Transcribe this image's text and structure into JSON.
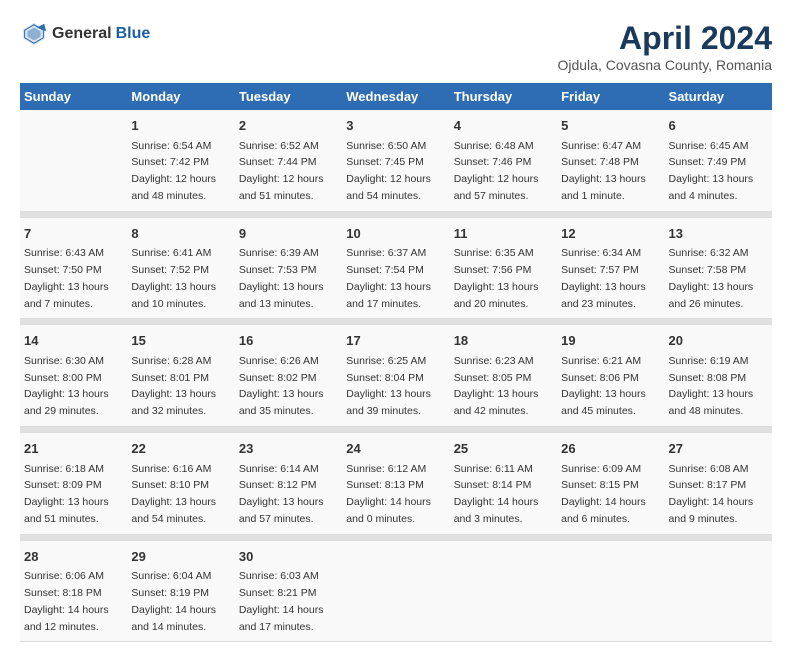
{
  "header": {
    "logo_general": "General",
    "logo_blue": "Blue",
    "title": "April 2024",
    "subtitle": "Ojdula, Covasna County, Romania"
  },
  "weekdays": [
    "Sunday",
    "Monday",
    "Tuesday",
    "Wednesday",
    "Thursday",
    "Friday",
    "Saturday"
  ],
  "weeks": [
    [
      {
        "day": "",
        "sunrise": "",
        "sunset": "",
        "daylight": ""
      },
      {
        "day": "1",
        "sunrise": "Sunrise: 6:54 AM",
        "sunset": "Sunset: 7:42 PM",
        "daylight": "Daylight: 12 hours and 48 minutes."
      },
      {
        "day": "2",
        "sunrise": "Sunrise: 6:52 AM",
        "sunset": "Sunset: 7:44 PM",
        "daylight": "Daylight: 12 hours and 51 minutes."
      },
      {
        "day": "3",
        "sunrise": "Sunrise: 6:50 AM",
        "sunset": "Sunset: 7:45 PM",
        "daylight": "Daylight: 12 hours and 54 minutes."
      },
      {
        "day": "4",
        "sunrise": "Sunrise: 6:48 AM",
        "sunset": "Sunset: 7:46 PM",
        "daylight": "Daylight: 12 hours and 57 minutes."
      },
      {
        "day": "5",
        "sunrise": "Sunrise: 6:47 AM",
        "sunset": "Sunset: 7:48 PM",
        "daylight": "Daylight: 13 hours and 1 minute."
      },
      {
        "day": "6",
        "sunrise": "Sunrise: 6:45 AM",
        "sunset": "Sunset: 7:49 PM",
        "daylight": "Daylight: 13 hours and 4 minutes."
      }
    ],
    [
      {
        "day": "7",
        "sunrise": "Sunrise: 6:43 AM",
        "sunset": "Sunset: 7:50 PM",
        "daylight": "Daylight: 13 hours and 7 minutes."
      },
      {
        "day": "8",
        "sunrise": "Sunrise: 6:41 AM",
        "sunset": "Sunset: 7:52 PM",
        "daylight": "Daylight: 13 hours and 10 minutes."
      },
      {
        "day": "9",
        "sunrise": "Sunrise: 6:39 AM",
        "sunset": "Sunset: 7:53 PM",
        "daylight": "Daylight: 13 hours and 13 minutes."
      },
      {
        "day": "10",
        "sunrise": "Sunrise: 6:37 AM",
        "sunset": "Sunset: 7:54 PM",
        "daylight": "Daylight: 13 hours and 17 minutes."
      },
      {
        "day": "11",
        "sunrise": "Sunrise: 6:35 AM",
        "sunset": "Sunset: 7:56 PM",
        "daylight": "Daylight: 13 hours and 20 minutes."
      },
      {
        "day": "12",
        "sunrise": "Sunrise: 6:34 AM",
        "sunset": "Sunset: 7:57 PM",
        "daylight": "Daylight: 13 hours and 23 minutes."
      },
      {
        "day": "13",
        "sunrise": "Sunrise: 6:32 AM",
        "sunset": "Sunset: 7:58 PM",
        "daylight": "Daylight: 13 hours and 26 minutes."
      }
    ],
    [
      {
        "day": "14",
        "sunrise": "Sunrise: 6:30 AM",
        "sunset": "Sunset: 8:00 PM",
        "daylight": "Daylight: 13 hours and 29 minutes."
      },
      {
        "day": "15",
        "sunrise": "Sunrise: 6:28 AM",
        "sunset": "Sunset: 8:01 PM",
        "daylight": "Daylight: 13 hours and 32 minutes."
      },
      {
        "day": "16",
        "sunrise": "Sunrise: 6:26 AM",
        "sunset": "Sunset: 8:02 PM",
        "daylight": "Daylight: 13 hours and 35 minutes."
      },
      {
        "day": "17",
        "sunrise": "Sunrise: 6:25 AM",
        "sunset": "Sunset: 8:04 PM",
        "daylight": "Daylight: 13 hours and 39 minutes."
      },
      {
        "day": "18",
        "sunrise": "Sunrise: 6:23 AM",
        "sunset": "Sunset: 8:05 PM",
        "daylight": "Daylight: 13 hours and 42 minutes."
      },
      {
        "day": "19",
        "sunrise": "Sunrise: 6:21 AM",
        "sunset": "Sunset: 8:06 PM",
        "daylight": "Daylight: 13 hours and 45 minutes."
      },
      {
        "day": "20",
        "sunrise": "Sunrise: 6:19 AM",
        "sunset": "Sunset: 8:08 PM",
        "daylight": "Daylight: 13 hours and 48 minutes."
      }
    ],
    [
      {
        "day": "21",
        "sunrise": "Sunrise: 6:18 AM",
        "sunset": "Sunset: 8:09 PM",
        "daylight": "Daylight: 13 hours and 51 minutes."
      },
      {
        "day": "22",
        "sunrise": "Sunrise: 6:16 AM",
        "sunset": "Sunset: 8:10 PM",
        "daylight": "Daylight: 13 hours and 54 minutes."
      },
      {
        "day": "23",
        "sunrise": "Sunrise: 6:14 AM",
        "sunset": "Sunset: 8:12 PM",
        "daylight": "Daylight: 13 hours and 57 minutes."
      },
      {
        "day": "24",
        "sunrise": "Sunrise: 6:12 AM",
        "sunset": "Sunset: 8:13 PM",
        "daylight": "Daylight: 14 hours and 0 minutes."
      },
      {
        "day": "25",
        "sunrise": "Sunrise: 6:11 AM",
        "sunset": "Sunset: 8:14 PM",
        "daylight": "Daylight: 14 hours and 3 minutes."
      },
      {
        "day": "26",
        "sunrise": "Sunrise: 6:09 AM",
        "sunset": "Sunset: 8:15 PM",
        "daylight": "Daylight: 14 hours and 6 minutes."
      },
      {
        "day": "27",
        "sunrise": "Sunrise: 6:08 AM",
        "sunset": "Sunset: 8:17 PM",
        "daylight": "Daylight: 14 hours and 9 minutes."
      }
    ],
    [
      {
        "day": "28",
        "sunrise": "Sunrise: 6:06 AM",
        "sunset": "Sunset: 8:18 PM",
        "daylight": "Daylight: 14 hours and 12 minutes."
      },
      {
        "day": "29",
        "sunrise": "Sunrise: 6:04 AM",
        "sunset": "Sunset: 8:19 PM",
        "daylight": "Daylight: 14 hours and 14 minutes."
      },
      {
        "day": "30",
        "sunrise": "Sunrise: 6:03 AM",
        "sunset": "Sunset: 8:21 PM",
        "daylight": "Daylight: 14 hours and 17 minutes."
      },
      {
        "day": "",
        "sunrise": "",
        "sunset": "",
        "daylight": ""
      },
      {
        "day": "",
        "sunrise": "",
        "sunset": "",
        "daylight": ""
      },
      {
        "day": "",
        "sunrise": "",
        "sunset": "",
        "daylight": ""
      },
      {
        "day": "",
        "sunrise": "",
        "sunset": "",
        "daylight": ""
      }
    ]
  ]
}
